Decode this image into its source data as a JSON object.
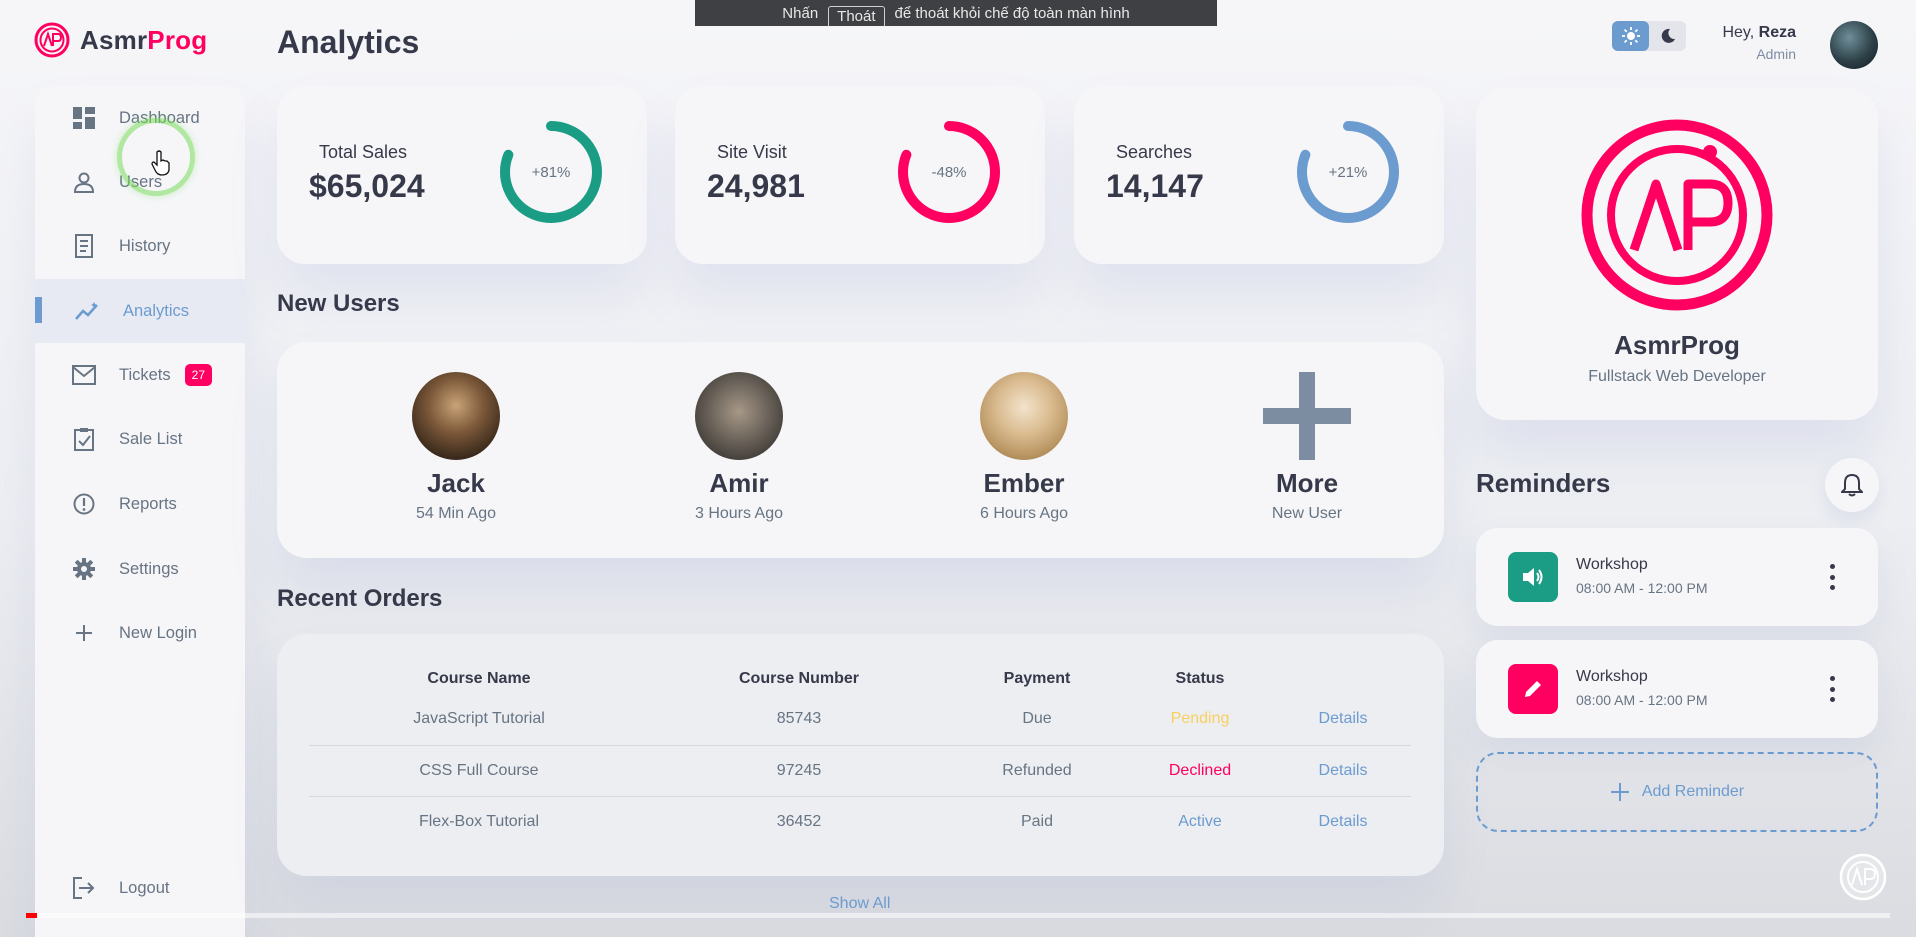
{
  "brand": {
    "name_main": "Asmr",
    "name_accent": "Prog"
  },
  "overlay": {
    "prefix": "Nhấn",
    "key": "Thoát",
    "suffix": "để thoát khỏi chế độ toàn màn hình"
  },
  "header": {
    "title": "Analytics",
    "greeting": "Hey,",
    "user": "Reza",
    "role": "Admin"
  },
  "sidebar": {
    "items": [
      {
        "label": "Dashboard",
        "icon": "dashboard-icon"
      },
      {
        "label": "Users",
        "icon": "user-icon"
      },
      {
        "label": "History",
        "icon": "history-icon"
      },
      {
        "label": "Analytics",
        "icon": "analytics-icon",
        "active": true
      },
      {
        "label": "Tickets",
        "icon": "mail-icon",
        "badge": "27"
      },
      {
        "label": "Sale List",
        "icon": "clipboard-check-icon"
      },
      {
        "label": "Reports",
        "icon": "report-icon"
      },
      {
        "label": "Settings",
        "icon": "gear-icon"
      },
      {
        "label": "New Login",
        "icon": "plus-icon"
      }
    ],
    "logout": "Logout"
  },
  "stats": [
    {
      "label": "Total Sales",
      "value": "$65,024",
      "percent": "+81%",
      "fraction": 0.81,
      "color": "#1b9c85"
    },
    {
      "label": "Site Visit",
      "value": "24,981",
      "percent": "-48%",
      "fraction": 0.81,
      "color": "#ff0060"
    },
    {
      "label": "Searches",
      "value": "14,147",
      "percent": "+21%",
      "fraction": 0.81,
      "color": "#6c9bcf"
    }
  ],
  "new_users": {
    "title": "New Users",
    "users": [
      {
        "name": "Jack",
        "time": "54 Min Ago"
      },
      {
        "name": "Amir",
        "time": "3 Hours Ago"
      },
      {
        "name": "Ember",
        "time": "6 Hours Ago"
      },
      {
        "name": "More",
        "time": "New User"
      }
    ]
  },
  "orders": {
    "title": "Recent Orders",
    "columns": [
      "Course Name",
      "Course Number",
      "Payment",
      "Status",
      ""
    ],
    "rows": [
      {
        "course": "JavaScript Tutorial",
        "number": "85743",
        "payment": "Due",
        "status": "Pending",
        "status_color": "#f7d060",
        "action": "Details"
      },
      {
        "course": "CSS Full Course",
        "number": "97245",
        "payment": "Refunded",
        "status": "Declined",
        "status_color": "#ff0060",
        "action": "Details"
      },
      {
        "course": "Flex-Box Tutorial",
        "number": "36452",
        "payment": "Paid",
        "status": "Active",
        "status_color": "#6c9bcf",
        "action": "Details"
      }
    ],
    "show_all": "Show All"
  },
  "profile": {
    "name": "AsmrProg",
    "title": "Fullstack Web Developer"
  },
  "reminders": {
    "title": "Reminders",
    "items": [
      {
        "title": "Workshop",
        "time": "08:00 AM - 12:00 PM",
        "icon": "volume-icon",
        "color": "#1b9c85"
      },
      {
        "title": "Workshop",
        "time": "08:00 AM - 12:00 PM",
        "icon": "edit-icon",
        "color": "#ff0060"
      }
    ],
    "add_label": "Add Reminder"
  },
  "video": {
    "progress": 0.006
  },
  "colors": {
    "primary": "#6c9bcf",
    "danger": "#ff0060",
    "success": "#1b9c85",
    "warning": "#f7d060"
  }
}
